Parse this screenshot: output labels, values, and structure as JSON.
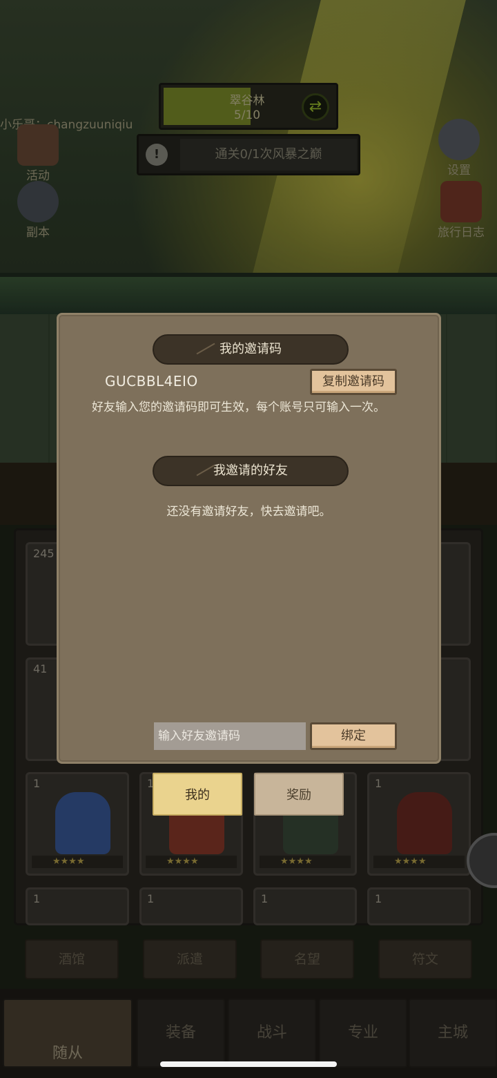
{
  "hud": {
    "area_name": "翠谷林",
    "area_progress": "5/10",
    "quest_text": "通关0/1次风暴之巅",
    "player_name": "小乐哥：changzuuniqiu"
  },
  "side_buttons": {
    "activity": "活动",
    "dungeon": "副本",
    "settings": "设置",
    "travel_log": "旅行日志"
  },
  "roster": {
    "cards": [
      {
        "level": "245"
      },
      {
        "level": "41"
      },
      {
        "level": "1"
      },
      {
        "level": "1"
      },
      {
        "level": "1"
      },
      {
        "level": "1"
      },
      {
        "level": "1"
      },
      {
        "level": "1"
      },
      {
        "level": "1"
      },
      {
        "level": "1"
      }
    ]
  },
  "bottom_tabs": [
    "酒馆",
    "派遣",
    "名望",
    "符文"
  ],
  "nav": [
    "随从",
    "装备",
    "战斗",
    "专业",
    "主城"
  ],
  "dialog": {
    "my_code_title": "我的邀请码",
    "my_code": "GUCBBL4EIO",
    "copy_label": "复制邀请码",
    "description": "好友输入您的邀请码即可生效，每个账号只可输入一次。",
    "friends_title": "我邀请的好友",
    "empty_message": "还没有邀请好友，快去邀请吧。",
    "input_placeholder": "输入好友邀请码",
    "bind_label": "绑定",
    "tabs": {
      "mine": "我的",
      "reward": "奖励"
    }
  },
  "colors": {
    "dialog_bg": "#7e705b",
    "ribbon_bg": "#3c3327",
    "wood_button": "#e3c39c",
    "tab_active": "#ead38e"
  }
}
